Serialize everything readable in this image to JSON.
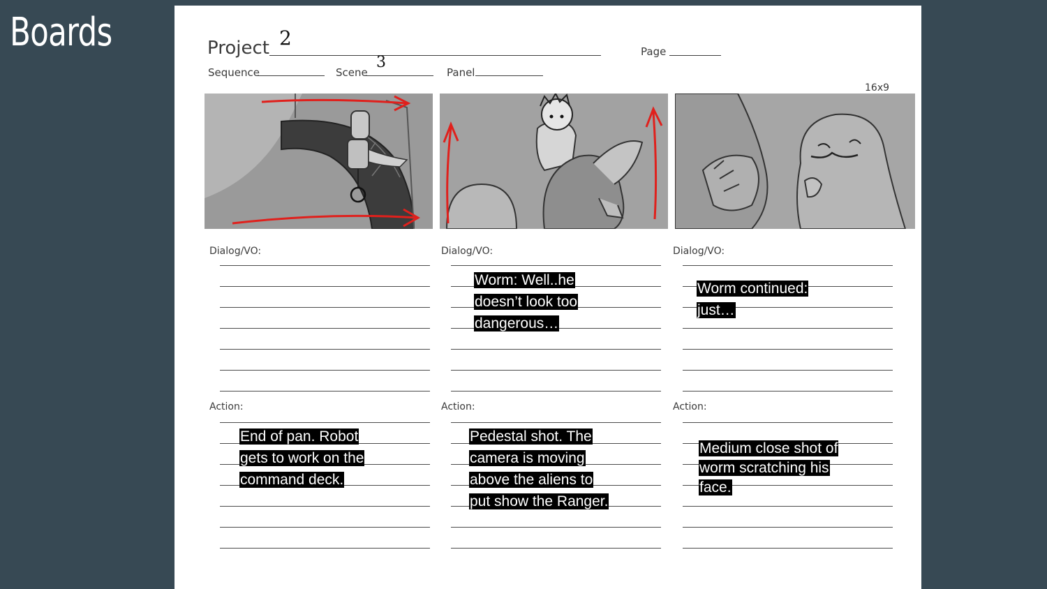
{
  "slide": {
    "title": "Boards"
  },
  "form": {
    "project_label": "Project",
    "project_value": "2",
    "page_label": "Page",
    "sequence_label": "Sequence",
    "scene_label": "Scene",
    "scene_value": "3",
    "panel_label": "Panel",
    "aspect": "16x9"
  },
  "panels": [
    {
      "dialog_label": "Dialog/VO:",
      "dialog_lines": [],
      "action_label": "Action:",
      "action_lines": [
        "End of pan. Robot",
        "gets to work on the",
        "command deck."
      ]
    },
    {
      "dialog_label": "Dialog/VO:",
      "dialog_lines": [
        "Worm: Well..he",
        "doesn’t look too",
        "dangerous…"
      ],
      "action_label": "Action:",
      "action_lines": [
        "Pedestal shot. The",
        "camera is moving",
        "above the aliens to",
        "put show the Ranger."
      ]
    },
    {
      "dialog_label": "Dialog/VO:",
      "dialog_lines": [
        "Worm continued:",
        "just…"
      ],
      "action_label": "Action:",
      "action_lines": [
        "Medium close shot of",
        "worm scratching his",
        "face."
      ]
    }
  ],
  "colors": {
    "background": "#374954",
    "sheet": "#ffffff",
    "arrow": "#e0201c",
    "highlight": "#000000"
  }
}
